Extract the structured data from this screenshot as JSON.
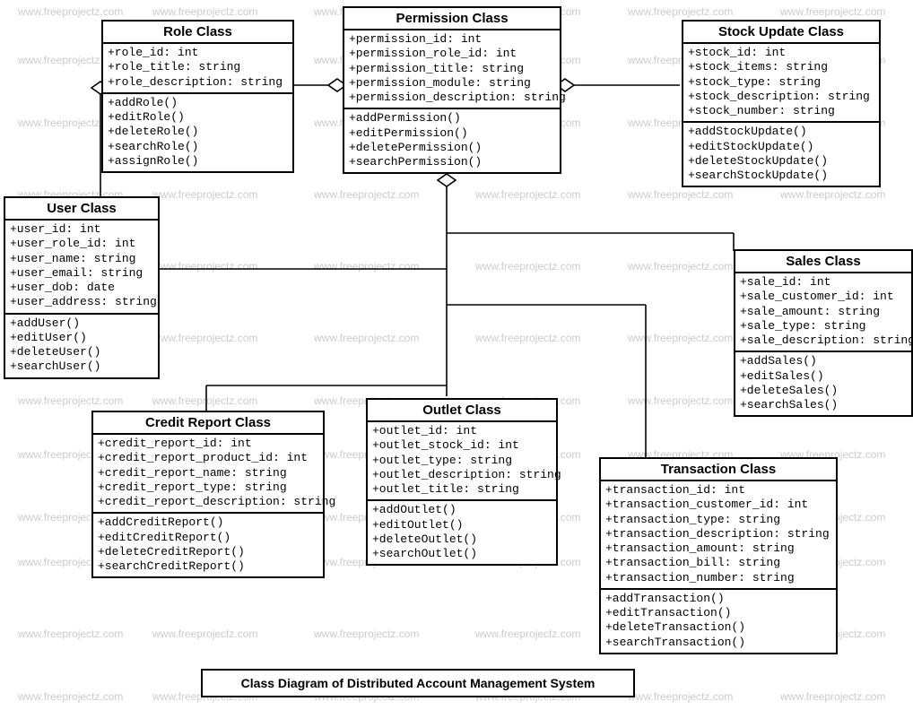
{
  "diagram_title": "Class Diagram of Distributed Account Management System",
  "watermark": "www.freeprojectz.com",
  "classes": {
    "role": {
      "title": "Role Class",
      "attrs": [
        "+role_id: int",
        "+role_title: string",
        "+role_description: string"
      ],
      "ops": [
        "+addRole()",
        "+editRole()",
        "+deleteRole()",
        "+searchRole()",
        "+assignRole()"
      ]
    },
    "permission": {
      "title": "Permission Class",
      "attrs": [
        "+permission_id: int",
        "+permission_role_id: int",
        "+permission_title: string",
        "+permission_module: string",
        "+permission_description: string"
      ],
      "ops": [
        "+addPermission()",
        "+editPermission()",
        "+deletePermission()",
        "+searchPermission()"
      ]
    },
    "stock": {
      "title": "Stock Update Class",
      "attrs": [
        "+stock_id: int",
        "+stock_items: string",
        "+stock_type: string",
        "+stock_description: string",
        "+stock_number: string"
      ],
      "ops": [
        "+addStockUpdate()",
        "+editStockUpdate()",
        "+deleteStockUpdate()",
        "+searchStockUpdate()"
      ]
    },
    "user": {
      "title": "User Class",
      "attrs": [
        "+user_id: int",
        "+user_role_id: int",
        "+user_name: string",
        "+user_email: string",
        "+user_dob: date",
        "+user_address: string"
      ],
      "ops": [
        "+addUser()",
        "+editUser()",
        "+deleteUser()",
        "+searchUser()"
      ]
    },
    "sales": {
      "title": "Sales Class",
      "attrs": [
        "+sale_id: int",
        "+sale_customer_id: int",
        "+sale_amount: string",
        "+sale_type: string",
        "+sale_description: string"
      ],
      "ops": [
        "+addSales()",
        "+editSales()",
        "+deleteSales()",
        "+searchSales()"
      ]
    },
    "outlet": {
      "title": "Outlet Class",
      "attrs": [
        "+outlet_id: int",
        "+outlet_stock_id: int",
        "+outlet_type: string",
        "+outlet_description: string",
        "+outlet_title: string"
      ],
      "ops": [
        "+addOutlet()",
        "+editOutlet()",
        "+deleteOutlet()",
        "+searchOutlet()"
      ]
    },
    "credit": {
      "title": "Credit Report Class",
      "attrs": [
        "+credit_report_id: int",
        "+credit_report_product_id: int",
        "+credit_report_name: string",
        "+credit_report_type: string",
        "+credit_report_description: string"
      ],
      "ops": [
        "+addCreditReport()",
        "+editCreditReport()",
        "+deleteCreditReport()",
        "+searchCreditReport()"
      ]
    },
    "transaction": {
      "title": "Transaction Class",
      "attrs": [
        "+transaction_id: int",
        "+transaction_customer_id: int",
        "+transaction_type: string",
        "+transaction_description: string",
        "+transaction_amount: string",
        "+transaction_bill: string",
        "+transaction_number: string"
      ],
      "ops": [
        "+addTransaction()",
        "+editTransaction()",
        "+deleteTransaction()",
        "+searchTransaction()"
      ]
    }
  }
}
